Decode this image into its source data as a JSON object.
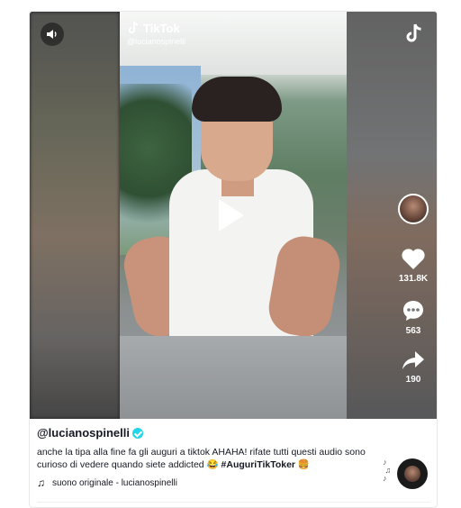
{
  "watermark": {
    "brand": "TikTok",
    "username": "@lucianospinelli"
  },
  "actions": {
    "likes": "131.8K",
    "comments": "563",
    "shares": "190"
  },
  "post": {
    "username": "@lucianospinelli",
    "description": "anche la tipa alla fine fa gli auguri a tiktok AHAHA! rifate tutti questi audio sono curioso di vedere quando siete addicted 😂 ",
    "hashtag": "#AuguriTikToker",
    "emoji_end": " 🍔",
    "music": "suono originale - lucianospinelli"
  },
  "icons": [
    "sound-icon",
    "tiktok-logo-icon",
    "play-icon",
    "heart-icon",
    "comment-icon",
    "share-icon",
    "music-note-icon",
    "verified-icon"
  ],
  "colors": {
    "verified": "#20d5ec",
    "text": "#161823"
  }
}
